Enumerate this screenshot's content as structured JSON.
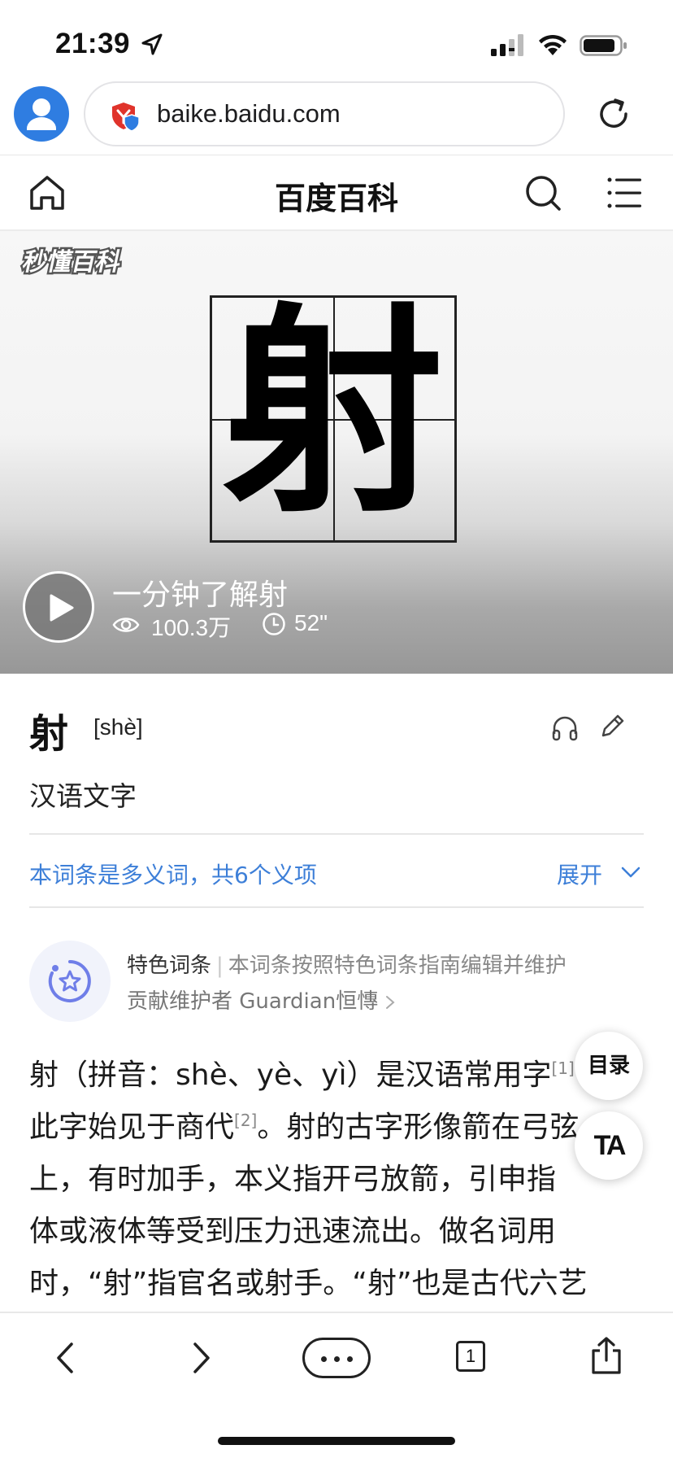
{
  "status_bar": {
    "time": "21:39"
  },
  "browser": {
    "url": "baike.baidu.com"
  },
  "site": {
    "title": "百度百科"
  },
  "video": {
    "brand_logo_text": "秒懂百科",
    "character": "射",
    "title": "一分钟了解射",
    "views": "100.3万",
    "duration": "52\""
  },
  "entry": {
    "character": "射",
    "pinyin": "[shè]",
    "subtitle": "汉语文字",
    "polysemy_note": "本词条是多义词，共6个义项",
    "expand_label": "展开"
  },
  "feature": {
    "label": "特色词条",
    "separator": "|",
    "description": "本词条按照特色词条指南编辑并维护",
    "contributor": "贡献维护者 Guardian恒慱"
  },
  "article": {
    "line1_text": "射（拼音：shè、yè、yì）是汉语常用字",
    "line1_ref": "[1]",
    "line2_text_a": "此字始见于商代",
    "line2_ref": "[2]",
    "line2_text_b": "。射的古字形像箭在弓弦",
    "line3_text": "上，有时加手，本义指开弓放箭，引申指",
    "line4_text": "体或液体等受到压力迅速流出。做名词用",
    "line5_text": "时，“射”指官名或射手。“射”也是古代六艺"
  },
  "floating": {
    "toc_label": "目录",
    "font_label": "TA"
  },
  "toolbar": {
    "tab_count": "1"
  },
  "colors": {
    "link_blue": "#3d7fd8",
    "avatar_blue": "#2f7de1",
    "badge_purple": "#6f7ee8"
  }
}
